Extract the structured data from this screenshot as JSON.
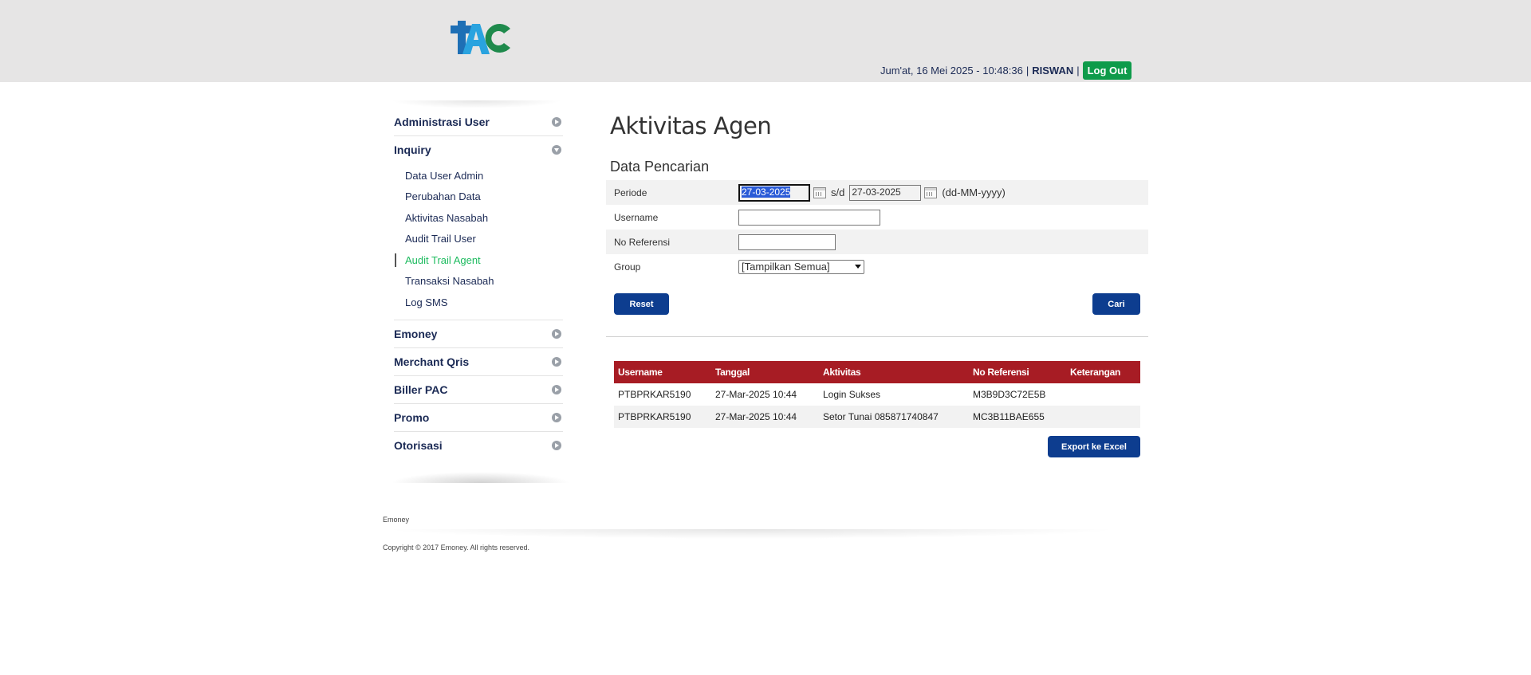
{
  "header": {
    "logo_text": "PAC",
    "datetime": "Jum'at, 16 Mei 2025 - 10:48:36",
    "separator": "|",
    "user": "RISWAN",
    "logout_label": "Log Out"
  },
  "sidebar": {
    "items": [
      {
        "label": "Administrasi User"
      },
      {
        "label": "Inquiry"
      },
      {
        "label": "Emoney"
      },
      {
        "label": "Merchant Qris"
      },
      {
        "label": "Biller PAC"
      },
      {
        "label": "Promo"
      },
      {
        "label": "Otorisasi"
      }
    ],
    "inquiry_sub": [
      {
        "label": "Data User Admin"
      },
      {
        "label": "Perubahan Data"
      },
      {
        "label": "Aktivitas Nasabah"
      },
      {
        "label": "Audit Trail User"
      },
      {
        "label": "Audit Trail Agent"
      },
      {
        "label": "Transaksi Nasabah"
      },
      {
        "label": "Log SMS"
      }
    ]
  },
  "page": {
    "title": "Aktivitas Agen",
    "section_title": "Data Pencarian"
  },
  "form": {
    "periode_label": "Periode",
    "date_from": "27-03-2025",
    "sd_label": "s/d",
    "date_to": "27-03-2025",
    "date_format": "(dd-MM-yyyy)",
    "username_label": "Username",
    "username_value": "",
    "noref_label": "No Referensi",
    "noref_value": "",
    "group_label": "Group",
    "group_selected": "[Tampilkan Semua]",
    "reset_label": "Reset",
    "search_label": "Cari"
  },
  "table": {
    "headers": [
      "Username",
      "Tanggal",
      "Aktivitas",
      "No Referensi",
      "Keterangan"
    ],
    "rows": [
      [
        "PTBPRKAR5190",
        "27-Mar-2025 10:44",
        "Login Sukses",
        "M3B9D3C72E5B",
        ""
      ],
      [
        "PTBPRKAR5190",
        "27-Mar-2025 10:44",
        "Setor Tunai 085871740847",
        "MC3B11BAE655",
        ""
      ]
    ],
    "export_label": "Export ke Excel"
  },
  "footer": {
    "label": "Emoney",
    "copyright": "Copyright © 2017 Emoney. All rights reserved."
  },
  "colors": {
    "header_bg": "#e6e5e5",
    "nav_text": "#1b2a55",
    "active_item": "#1dbb5f",
    "logout_bg": "#0e9b4a",
    "button_bg": "#0d3d8f",
    "table_header_bg": "#a71c24"
  }
}
